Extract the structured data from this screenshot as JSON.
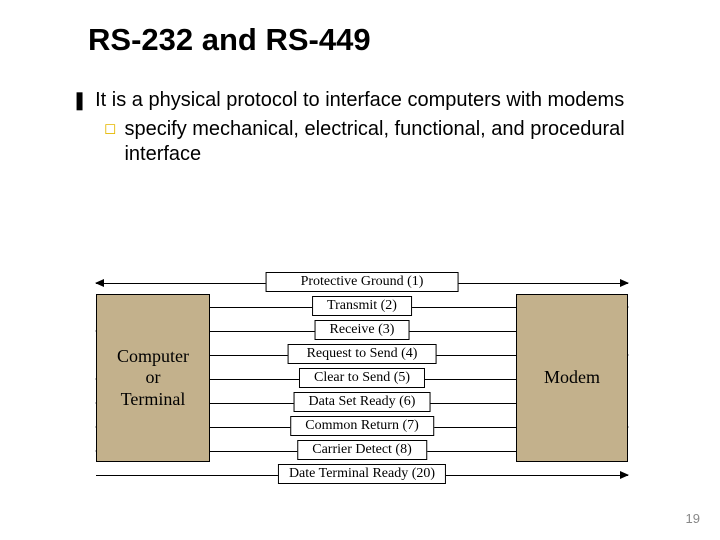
{
  "title": "RS-232 and RS-449",
  "bullets": {
    "level1_text": "It is a physical protocol to interface computers with modems",
    "level2_text": "specify mechanical, electrical, functional, and procedural interface"
  },
  "left_box": {
    "l1": "Computer",
    "l2": "or",
    "l3": "Terminal"
  },
  "right_box": {
    "l1": "Modem"
  },
  "signals": [
    {
      "label": "Protective Ground (1)",
      "dir": "both"
    },
    {
      "label": "Transmit (2)",
      "dir": "right"
    },
    {
      "label": "Receive (3)",
      "dir": "left"
    },
    {
      "label": "Request to Send (4)",
      "dir": "right"
    },
    {
      "label": "Clear to Send (5)",
      "dir": "left"
    },
    {
      "label": "Data Set Ready (6)",
      "dir": "left"
    },
    {
      "label": "Common Return (7)",
      "dir": "both"
    },
    {
      "label": "Carrier Detect (8)",
      "dir": "left"
    },
    {
      "label": "Date Terminal Ready (20)",
      "dir": "right"
    }
  ],
  "page_number": "19"
}
